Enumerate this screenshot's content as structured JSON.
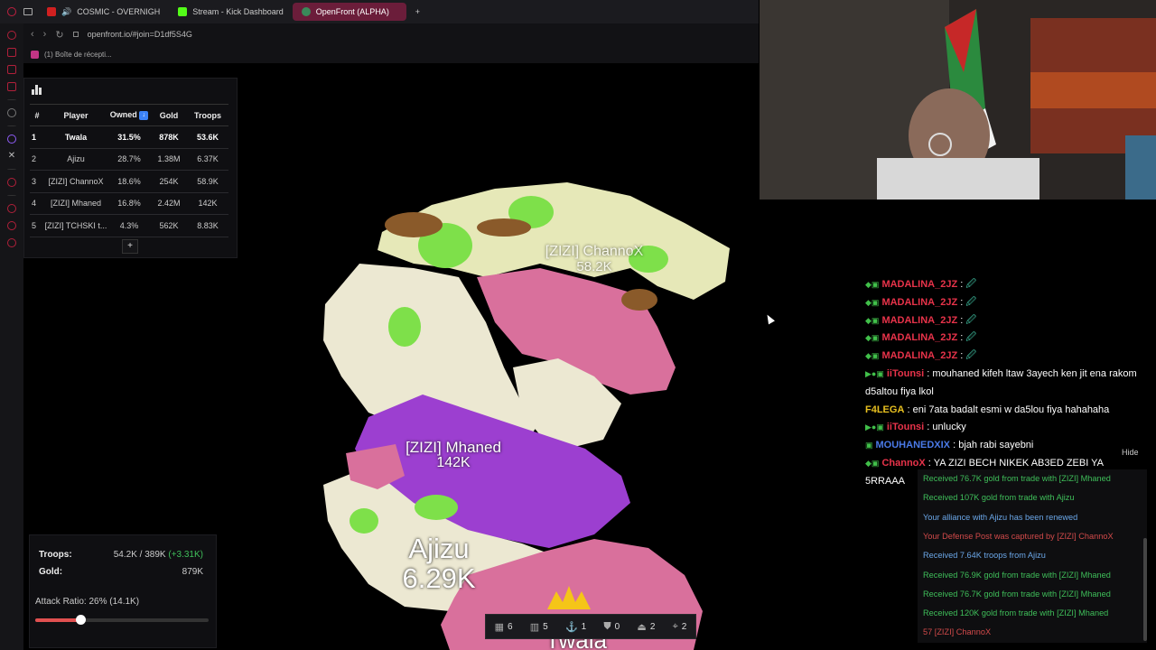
{
  "browser": {
    "tabs": [
      {
        "label": "COSMIC - OVERNIGH",
        "color": "#d02020"
      },
      {
        "label": "Stream - Kick Dashboard",
        "color": "#53fc18"
      },
      {
        "label": "OpenFront (ALPHA)",
        "color": "#3a8a5a"
      }
    ],
    "new_tab": "+",
    "url": "openfront.io/#join=D1df5S4G",
    "bookmark": "(1) Boîte de récepti..."
  },
  "leaderboard": {
    "headers": [
      "#",
      "Player",
      "Owned",
      "Gold",
      "Troops"
    ],
    "sort_icon": "↓",
    "rows": [
      {
        "rank": "1",
        "player": "Twala",
        "owned": "31.5%",
        "gold": "878K",
        "troops": "53.6K"
      },
      {
        "rank": "2",
        "player": "Ajizu",
        "owned": "28.7%",
        "gold": "1.38M",
        "troops": "6.37K"
      },
      {
        "rank": "3",
        "player": "[ZIZI] ChannoX",
        "owned": "18.6%",
        "gold": "254K",
        "troops": "58.9K"
      },
      {
        "rank": "4",
        "player": "[ZIZI] Mhaned",
        "owned": "16.8%",
        "gold": "2.42M",
        "troops": "142K"
      },
      {
        "rank": "5",
        "player": "[ZIZI] TCHSKI t...",
        "owned": "4.3%",
        "gold": "562K",
        "troops": "8.83K"
      }
    ],
    "add_label": "+"
  },
  "stats": {
    "troops_label": "Troops:",
    "troops_value": "54.2K / 389K",
    "troops_gain": "(+3.31K)",
    "gold_label": "Gold:",
    "gold_value": "879K",
    "attack_ratio_label": "Attack Ratio: 26% (14.1K)",
    "attack_ratio": 0.26
  },
  "map": {
    "labels": {
      "channox_name": "[ZIZI] ChannoX",
      "channox_troops": "58.2K",
      "mhaned_name": "[ZIZI] Mhaned",
      "mhaned_troops": "142K",
      "ajizu_name": "Ajizu",
      "ajizu_troops": "6.29K",
      "twala_name": "Twala"
    },
    "colors": {
      "sea": "#000000",
      "twala": "#d9709c",
      "ajizu": "#ece8d2",
      "channox": "#e6e8b8",
      "mhaned": "#9c3fd0",
      "forest": "#7ee04a",
      "mountain": "#8a5a2a"
    }
  },
  "buildbar": {
    "items": [
      {
        "icon": "city-icon",
        "glyph": "▦",
        "count": "6"
      },
      {
        "icon": "factory-icon",
        "glyph": "▥",
        "count": "5"
      },
      {
        "icon": "port-icon",
        "glyph": "⚓",
        "count": "1"
      },
      {
        "icon": "defense-post-icon",
        "glyph": "⛊",
        "count": "0"
      },
      {
        "icon": "missile-silo-icon",
        "glyph": "⏏",
        "count": "2"
      },
      {
        "icon": "sam-launcher-icon",
        "glyph": "⌖",
        "count": "2"
      }
    ]
  },
  "chat": {
    "lines": [
      {
        "user": "MADALINA_2JZ",
        "color": "#e8334a",
        "badge": "◆▣",
        "msg": "🖉"
      },
      {
        "user": "MADALINA_2JZ",
        "color": "#e8334a",
        "badge": "◆▣",
        "msg": "🖉"
      },
      {
        "user": "MADALINA_2JZ",
        "color": "#e8334a",
        "badge": "◆▣",
        "msg": "🖉"
      },
      {
        "user": "MADALINA_2JZ",
        "color": "#e8334a",
        "badge": "◆▣",
        "msg": "🖉"
      },
      {
        "user": "MADALINA_2JZ",
        "color": "#e8334a",
        "badge": "◆▣",
        "msg": "🖉"
      },
      {
        "user": "iiTounsi",
        "color": "#e8334a",
        "badge": "▶●▣",
        "msg": "mouhaned kifeh ltaw 3ayech ken jit ena rakom d5altou fiya lkol"
      },
      {
        "user": "F4LEGA",
        "color": "#e8c020",
        "badge": "",
        "msg": "eni 7ata badalt esmi w da5lou fiya hahahaha"
      },
      {
        "user": "iiTounsi",
        "color": "#e8334a",
        "badge": "▶●▣",
        "msg": "unlucky"
      },
      {
        "user": "MOUHANEDXIX",
        "color": "#4a7ae8",
        "badge": "▣",
        "msg": "bjah rabi sayebni"
      },
      {
        "user": "ChannoX",
        "color": "#e8334a",
        "badge": "◆▣",
        "msg": "YA ZIZI BECH NIKEK AB3ED ZEBI YA 5RRAAA"
      }
    ]
  },
  "events": {
    "hide_label": "Hide",
    "items": [
      {
        "text": "Received 76.7K gold from trade with [ZIZI] Mhaned",
        "kind": "green"
      },
      {
        "text": "Received 107K gold from trade with Ajizu",
        "kind": "green"
      },
      {
        "text": "Your alliance with Ajizu has been renewed",
        "kind": "blue"
      },
      {
        "text": "Your Defense Post was captured by [ZIZI] ChannoX",
        "kind": "red"
      },
      {
        "text": "Received 7.64K troops from Ajizu",
        "kind": "blue"
      },
      {
        "text": "Received 76.9K gold from trade with [ZIZI] Mhaned",
        "kind": "green"
      },
      {
        "text": "Received 76.7K gold from trade with [ZIZI] Mhaned",
        "kind": "green"
      },
      {
        "text": "Received 120K gold from trade with [ZIZI] Mhaned",
        "kind": "green"
      },
      {
        "text": "57 [ZIZI] ChannoX",
        "kind": "red"
      }
    ]
  }
}
